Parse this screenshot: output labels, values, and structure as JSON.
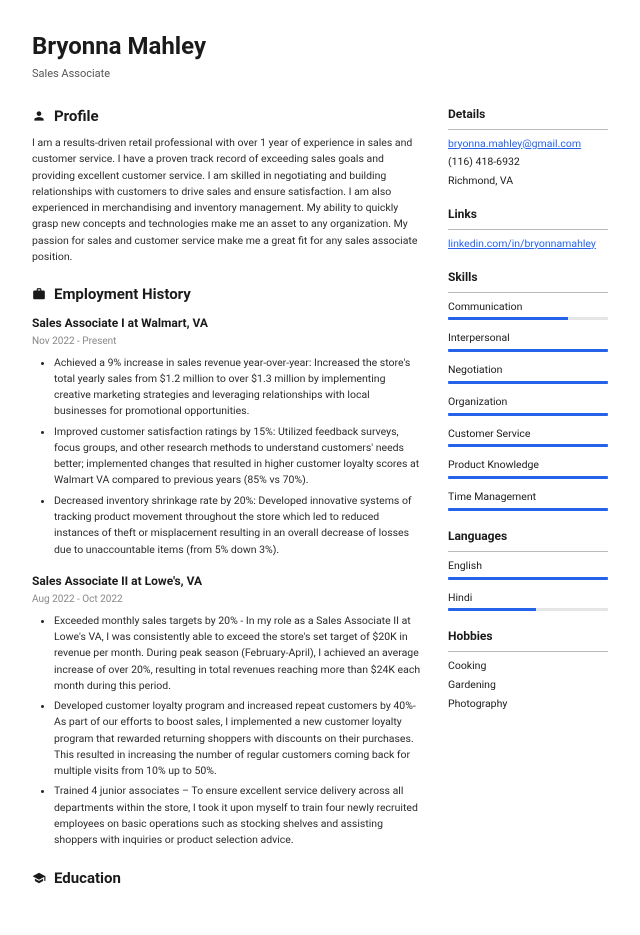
{
  "header": {
    "name": "Bryonna Mahley",
    "title": "Sales Associate"
  },
  "profile": {
    "heading": "Profile",
    "text": "I am a results-driven retail professional with over 1 year of experience in sales and customer service. I have a proven track record of exceeding sales goals and providing excellent customer service. I am skilled in negotiating and building relationships with customers to drive sales and ensure satisfaction. I am also experienced in merchandising and inventory management. My ability to quickly grasp new concepts and technologies make me an asset to any organization. My passion for sales and customer service make me a great fit for any sales associate position."
  },
  "employment": {
    "heading": "Employment History",
    "jobs": [
      {
        "title": "Sales Associate I at Walmart, VA",
        "dates": "Nov 2022 - Present",
        "bullets": [
          "Achieved a 9% increase in sales revenue year-over-year: Increased the store's total yearly sales from $1.2 million to over $1.3 million by implementing creative marketing strategies and leveraging relationships with local businesses for promotional opportunities.",
          "Improved customer satisfaction ratings by 15%: Utilized feedback surveys, focus groups, and other research methods to understand customers' needs better; implemented changes that resulted in higher customer loyalty scores at Walmart VA compared to previous years (85% vs 70%).",
          "Decreased inventory shrinkage rate by 20%: Developed innovative systems of tracking product movement throughout the store which led to reduced instances of theft or misplacement resulting in an overall decrease of losses due to unaccountable items (from 5% down 3%)."
        ]
      },
      {
        "title": "Sales Associate II at Lowe's, VA",
        "dates": "Aug 2022 - Oct 2022",
        "bullets": [
          "Exceeded monthly sales targets by 20% - In my role as a Sales Associate II at Lowe's VA, I was consistently able to exceed the store's set target of $20K in revenue per month. During peak season (February-April), I achieved an average increase of over 20%, resulting in total revenues reaching more than $24K each month during this period.",
          "Developed customer loyalty program and increased repeat customers by 40%- As part of our efforts to boost sales, I implemented a new customer loyalty program that rewarded returning shoppers with discounts on their purchases. This resulted in increasing the number of regular customers coming back for multiple visits from 10% up to 50%.",
          "Trained 4 junior associates – To ensure excellent service delivery across all departments within the store, I took it upon myself to train four newly recruited employees on basic operations such as stocking shelves and assisting shoppers with inquiries or product selection advice."
        ]
      }
    ]
  },
  "education": {
    "heading": "Education"
  },
  "details": {
    "heading": "Details",
    "email": "bryonna.mahley@gmail.com",
    "phone": "(116) 418-6932",
    "location": "Richmond, VA"
  },
  "links": {
    "heading": "Links",
    "items": [
      "linkedin.com/in/bryonnamahley"
    ]
  },
  "skills": {
    "heading": "Skills",
    "items": [
      {
        "name": "Communication",
        "level": 75
      },
      {
        "name": "Interpersonal",
        "level": 100
      },
      {
        "name": "Negotiation",
        "level": 100
      },
      {
        "name": "Organization",
        "level": 100
      },
      {
        "name": "Customer Service",
        "level": 100
      },
      {
        "name": "Product Knowledge",
        "level": 100
      },
      {
        "name": "Time Management",
        "level": 100
      }
    ]
  },
  "languages": {
    "heading": "Languages",
    "items": [
      {
        "name": "English",
        "level": 100
      },
      {
        "name": "Hindi",
        "level": 55
      }
    ]
  },
  "hobbies": {
    "heading": "Hobbies",
    "items": [
      "Cooking",
      "Gardening",
      "Photography"
    ]
  }
}
